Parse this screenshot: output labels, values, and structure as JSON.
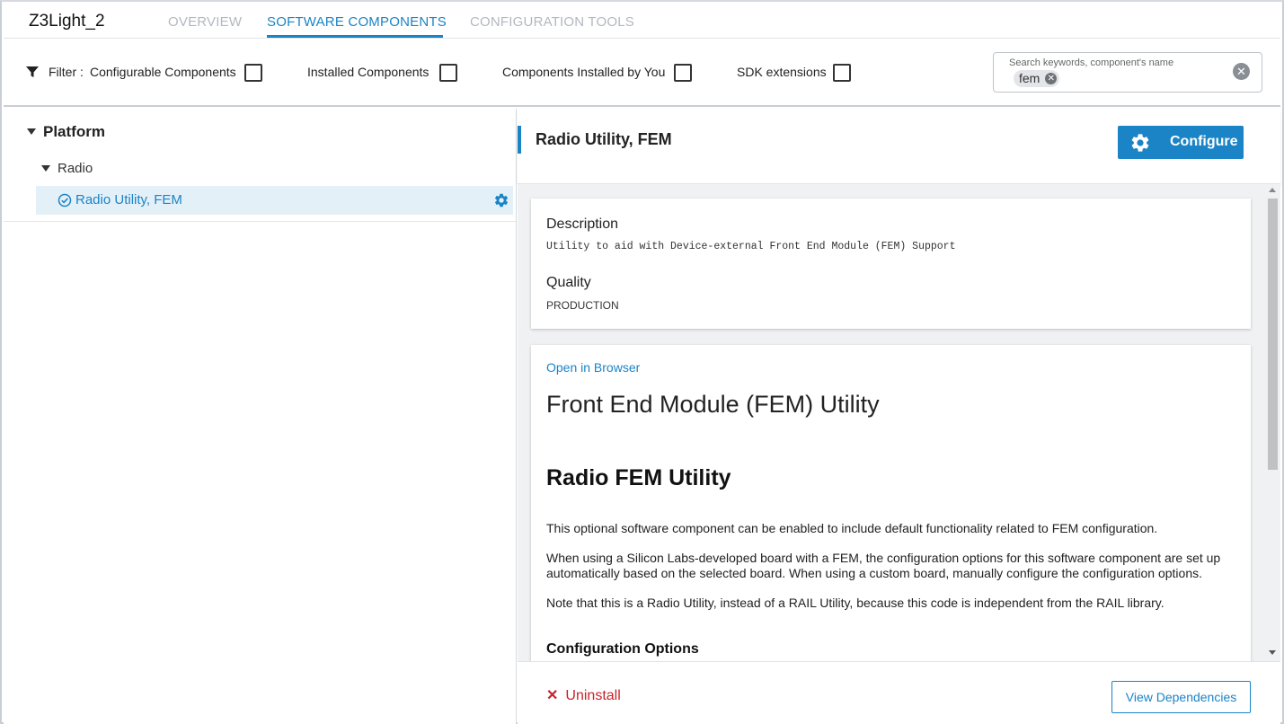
{
  "header": {
    "project_title": "Z3Light_2",
    "tabs": [
      {
        "label": "OVERVIEW",
        "active": false
      },
      {
        "label": "SOFTWARE COMPONENTS",
        "active": true
      },
      {
        "label": "CONFIGURATION TOOLS",
        "active": false
      }
    ]
  },
  "filters": {
    "label": "Filter :",
    "items": [
      {
        "label": "Configurable Components",
        "checked": false
      },
      {
        "label": "Installed Components",
        "checked": false
      },
      {
        "label": "Components Installed by You",
        "checked": false
      },
      {
        "label": "SDK extensions",
        "checked": false
      }
    ],
    "search": {
      "placeholder": "Search keywords, component's name",
      "chip": "fem"
    }
  },
  "tree": {
    "platform": "Platform",
    "radio": "Radio",
    "selected_item": "Radio Utility, FEM"
  },
  "detail": {
    "title": "Radio Utility, FEM",
    "configure_label": "Configure",
    "description_heading": "Description",
    "description_text": "Utility to aid with Device-external Front End Module (FEM) Support",
    "quality_heading": "Quality",
    "quality_value": "PRODUCTION",
    "doc": {
      "open_link": "Open in Browser",
      "h1": "Front End Module (FEM) Utility",
      "h2": "Radio FEM Utility",
      "p1": "This optional software component can be enabled to include default functionality related to FEM configuration.",
      "p2": "When using a Silicon Labs-developed board with a FEM, the configuration options for this software component are set up automatically based on the selected board. When using a custom board, manually configure the configuration options.",
      "p3": "Note that this is a Radio Utility, instead of a RAIL Utility, because this code is independent from the RAIL library.",
      "h3": "Configuration Options"
    },
    "uninstall_label": "Uninstall",
    "view_dependencies_label": "View Dependencies"
  },
  "colors": {
    "accent": "#1a84c6",
    "danger": "#c8232c",
    "selected_bg": "#e4f0f8"
  },
  "icons": {
    "filter": "funnel-icon",
    "check": "check-circle-icon",
    "gear": "gear-icon",
    "close": "close-icon"
  }
}
